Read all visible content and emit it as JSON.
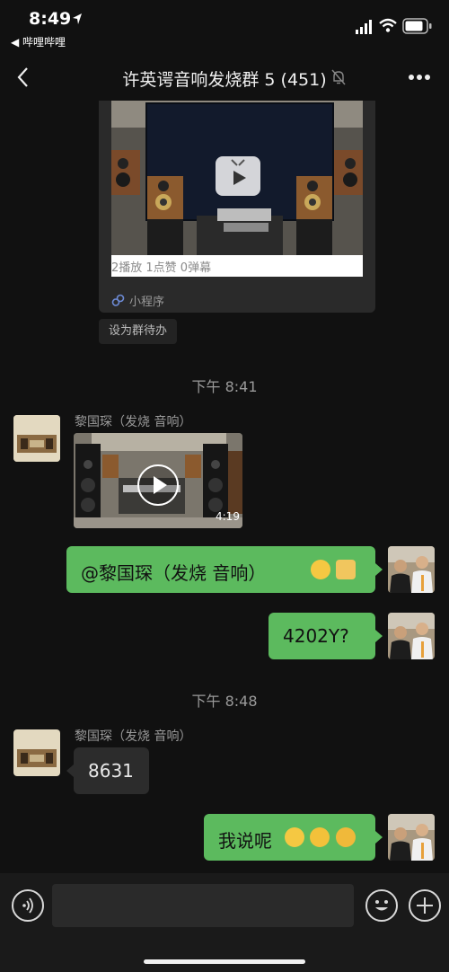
{
  "status_bar": {
    "time": "8:49",
    "back_app": "◀ 哔哩哔哩"
  },
  "header": {
    "title": "许英谔音响发烧群 5 (451)"
  },
  "miniprogram": {
    "stats": "2播放   1点赞   0弹幕",
    "label": "小程序",
    "set_todo": "设为群待办"
  },
  "timestamps": [
    "下午 8:41",
    "下午 8:48"
  ],
  "messages": {
    "m1_sender": "黎国琛（发烧 音响）",
    "m1_duration": "4:19",
    "m2_text": "@黎国琛（发烧 音响）",
    "m3_text": "4202Y?",
    "m4_sender": "黎国琛（发烧 音响）",
    "m4_text": "8631",
    "m5_text": "我说呢"
  },
  "colors": {
    "bubble_green": "#5cba5e",
    "bubble_gray": "#2c2c2c",
    "background": "#111111"
  },
  "icons": [
    "location-arrow-icon",
    "signal-icon",
    "wifi-icon",
    "battery-icon",
    "back-chevron-icon",
    "mute-bell-icon",
    "more-icon",
    "play-icon",
    "link-icon",
    "voice-icon",
    "emoji-icon",
    "plus-icon"
  ]
}
